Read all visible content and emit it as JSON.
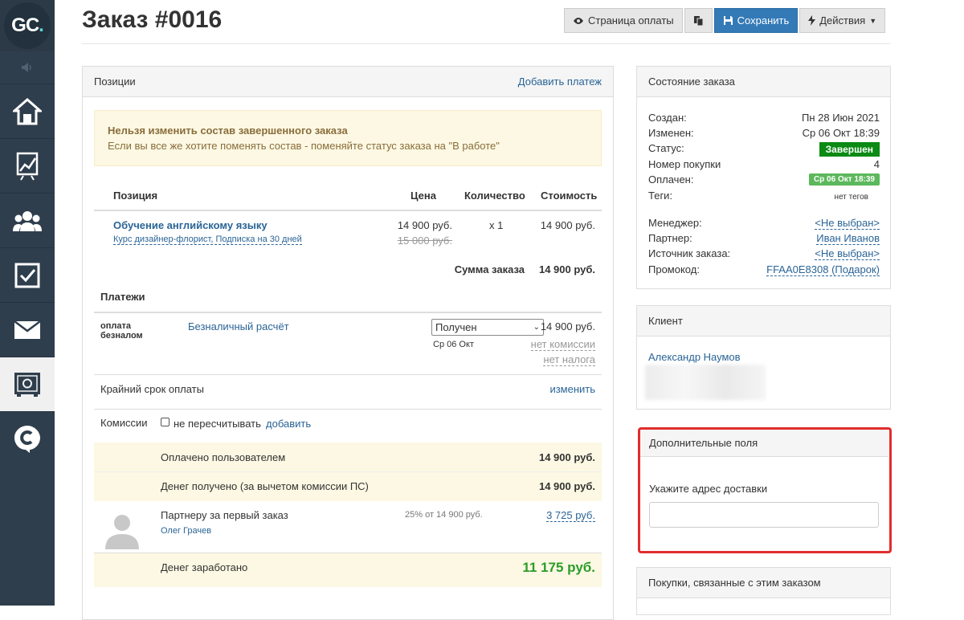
{
  "app": {
    "logo_text": "GC",
    "logo_dot": "."
  },
  "sidebar": {
    "items": [
      {
        "icon": "home-icon"
      },
      {
        "icon": "chart-icon"
      },
      {
        "icon": "users-icon"
      },
      {
        "icon": "tasks-icon"
      },
      {
        "icon": "mail-icon"
      },
      {
        "icon": "safe-icon",
        "active": true
      },
      {
        "icon": "chat-icon"
      }
    ]
  },
  "header": {
    "title": "Заказ #0016",
    "buttons": {
      "payment_page": "Страница оплаты",
      "save": "Сохранить",
      "actions": "Действия"
    }
  },
  "positions": {
    "header": "Позиции",
    "add_payment": "Добавить платеж",
    "warning_title": "Нельзя изменить состав завершенного заказа",
    "warning_text": "Если вы все же хотите поменять состав - поменяйте статус заказа на \"В работе\"",
    "columns": [
      "Позиция",
      "Цена",
      "Количество",
      "Стоимость"
    ],
    "item": {
      "name": "Обучение английскому языку",
      "sub": "Курс дизайнер-флорист, Подписка на 30 дней",
      "price": "14 900 руб.",
      "old_price": "15 000 руб.",
      "qty": "x 1",
      "cost": "14 900 руб."
    },
    "sum_label": "Сумма заказа",
    "sum_value": "14 900 руб."
  },
  "payments": {
    "header": "Платежи",
    "method_logo": "оплата безналом",
    "method_name": "Безналичный расчёт",
    "status_selected": "Получен",
    "status_date": "Ср 06 Окт",
    "amount": "14 900 руб.",
    "no_commission": "нет комиссии",
    "no_tax": "нет налога",
    "deadline_label": "Крайний срок оплаты",
    "deadline_link": "изменить",
    "commission_label": "Комиссии",
    "no_recount": "не пересчитывать",
    "add_link": "добавить",
    "paid_by_user_label": "Оплачено пользователем",
    "paid_by_user_value": "14 900 руб.",
    "received_label": "Денег получено (за вычетом комиссии ПС)",
    "received_value": "14 900 руб.",
    "partner_label": "Партнеру за первый заказ",
    "partner_name": "Олег Грачев",
    "partner_percent": "25% от 14 900 руб.",
    "partner_value": "3 725 руб.",
    "earned_label": "Денег заработано",
    "earned_value": "11 175 руб."
  },
  "order_state": {
    "header": "Состояние заказа",
    "created_label": "Создан:",
    "created_value": "Пн 28 Июн 2021",
    "changed_label": "Изменен:",
    "changed_value": "Ср 06 Окт 18:39",
    "status_label": "Статус:",
    "status_value": "Завершен",
    "purchase_label": "Номер покупки",
    "purchase_value": "4",
    "paid_label": "Оплачен:",
    "paid_value": "Ср 06 Окт 18:39",
    "tags_label": "Теги:",
    "tags_value": "нет тегов",
    "manager_label": "Менеджер:",
    "manager_value": "<Не выбран>",
    "partner_label": "Партнер:",
    "partner_value": "Иван Иванов",
    "source_label": "Источник заказа:",
    "source_value": "<Не выбран>",
    "promo_label": "Промокод:",
    "promo_value": "FFAA0E8308 (Подарок)"
  },
  "client": {
    "header": "Клиент",
    "name": "Александр Наумов"
  },
  "extra_fields": {
    "header": "Дополнительные поля",
    "address_label": "Укажите адрес доставки",
    "address_value": ""
  },
  "related": {
    "header": "Покупки, связанные с этим заказом"
  },
  "colors": {
    "sidebar": "#2f3e4d",
    "primary": "#337ab7",
    "status_green": "#0b8a14",
    "earned_green": "#2a9d2a",
    "highlight": "#e12d2d"
  }
}
